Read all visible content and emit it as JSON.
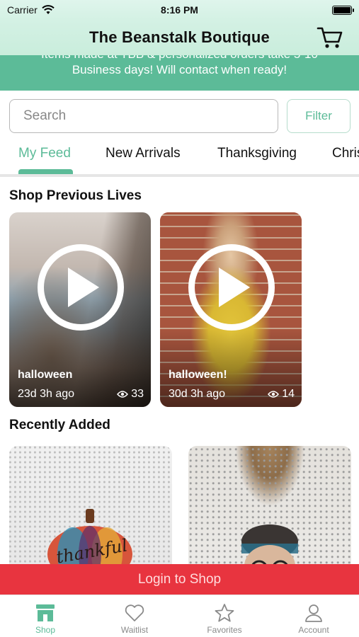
{
  "status_bar": {
    "carrier": "Carrier",
    "time": "8:16 PM"
  },
  "header": {
    "title": "The Beanstalk Boutique"
  },
  "banner": {
    "line1": "Items made at TBB & personalized orders take 5-10",
    "line2": "Business days! Will contact when ready!"
  },
  "search": {
    "placeholder": "Search",
    "filter_label": "Filter"
  },
  "tabs": [
    {
      "label": "My Feed",
      "active": true
    },
    {
      "label": "New Arrivals",
      "active": false
    },
    {
      "label": "Thanksgiving",
      "active": false
    },
    {
      "label": "Chris",
      "active": false
    }
  ],
  "previous_lives": {
    "title": "Shop Previous Lives",
    "items": [
      {
        "name": "halloween",
        "ago": "23d 3h ago",
        "views": "33"
      },
      {
        "name": "halloween!",
        "ago": "30d 3h ago",
        "views": "14"
      }
    ]
  },
  "recently_added": {
    "title": "Recently Added",
    "product_text": "thankful"
  },
  "login_bar": {
    "label": "Login to Shop"
  },
  "bottom_tabs": [
    {
      "label": "Shop",
      "icon": "shop-icon",
      "active": true
    },
    {
      "label": "Waitlist",
      "icon": "heart-icon",
      "active": false
    },
    {
      "label": "Favorites",
      "icon": "star-icon",
      "active": false
    },
    {
      "label": "Account",
      "icon": "person-icon",
      "active": false
    }
  ],
  "colors": {
    "accent": "#5cbb98",
    "login": "#e8343f",
    "header": "#d4f1e4"
  }
}
